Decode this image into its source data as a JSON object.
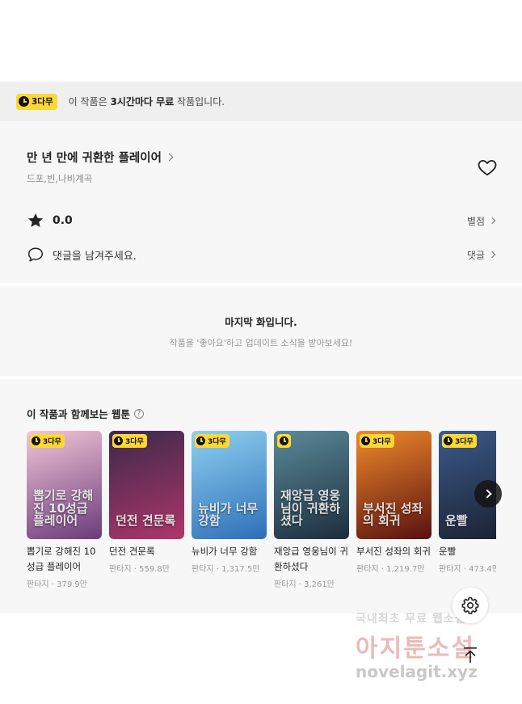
{
  "notice": {
    "badge": "3다무",
    "text_pre": "이 작품은 ",
    "text_bold": "3시간마다 무료",
    "text_post": " 작품입니다."
  },
  "work": {
    "title": "만 년 만에 귀환한 플레이어",
    "authors": "드포,빈,나비계곡",
    "rating": "0.0",
    "rating_link": "별점",
    "comment_placeholder": "댓글을 남겨주세요.",
    "comment_link": "댓글"
  },
  "last_episode": {
    "title": "마지막 화입니다.",
    "subtitle": "작품을 '좋아요'하고 업데이트 소식을 받아보세요!"
  },
  "recommendations": {
    "title": "이 작품과 함께보는 웹툰",
    "help": "?",
    "items": [
      {
        "title": "뽑기로 강해진 10성급 플레이어",
        "meta": "판타지 · 379.9만",
        "badge": "3다무",
        "art": "뽑기로 강해진 10성급 플레이어",
        "color1": "#f3c6d8",
        "color2": "#6a3b7a"
      },
      {
        "title": "던전 견문록",
        "meta": "판타지 · 559.8만",
        "badge": "3다무",
        "art": "던전 견문록",
        "color1": "#3a2a4a",
        "color2": "#b0356a"
      },
      {
        "title": "뉴비가 너무 강함",
        "meta": "판타지 · 1,317.5만",
        "badge": "3다무",
        "art": "뉴비가 너무 강함",
        "color1": "#8fd0f0",
        "color2": "#2d6fb8"
      },
      {
        "title": "재앙급 영웅님이 귀환하셨다",
        "meta": "판타지 · 3,261만",
        "badge": "",
        "art": "재앙급 영웅님이 귀환하셨다",
        "color1": "#5a8a9a",
        "color2": "#1d2d3d"
      },
      {
        "title": "부서진 성좌의 회귀",
        "meta": "판타지 · 1,219.7만",
        "badge": "3다무",
        "art": "부서진 성좌의 회귀",
        "color1": "#f08a2a",
        "color2": "#5a1010"
      },
      {
        "title": "운빨",
        "meta": "판타지 · 473.4만",
        "badge": "3다무",
        "art": "운빨",
        "color1": "#3a5a8a",
        "color2": "#1a2030"
      }
    ]
  },
  "watermark": {
    "line1a": "국내최초 무료",
    "line1b": "웹소설",
    "line2": "아지툰소설",
    "line3": "novelagit.xyz"
  }
}
